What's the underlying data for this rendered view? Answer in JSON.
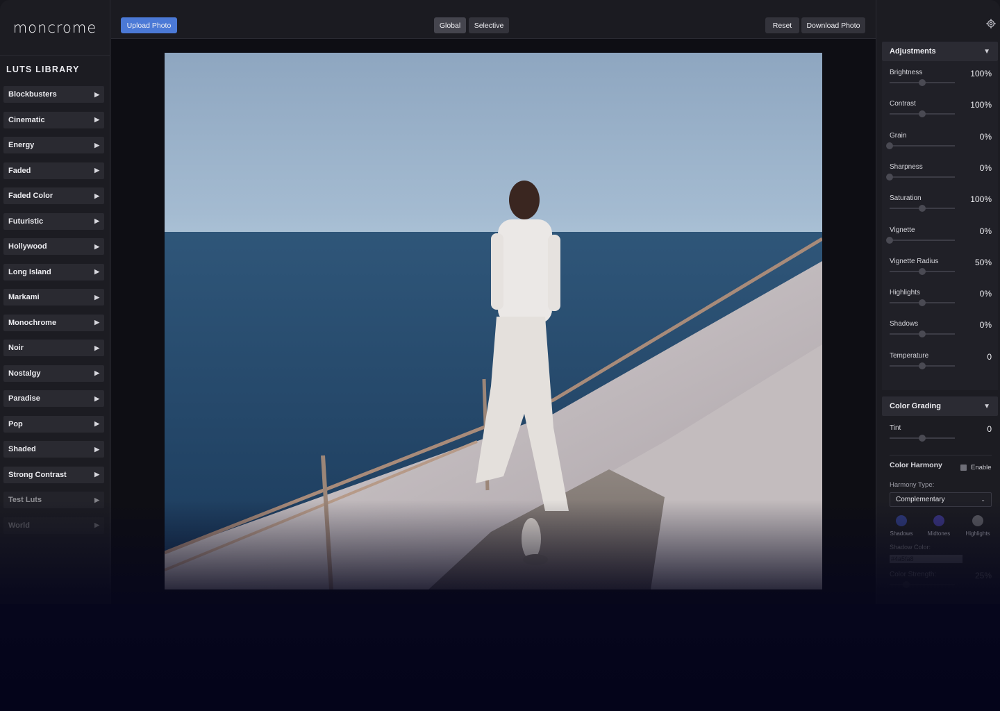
{
  "app": {
    "logo": "moncrome"
  },
  "sidebar": {
    "title": "LUTS LIBRARY",
    "items": [
      "Blockbusters",
      "Cinematic",
      "Energy",
      "Faded",
      "Faded Color",
      "Futuristic",
      "Hollywood",
      "Long Island",
      "Markami",
      "Monochrome",
      "Noir",
      "Nostalgy",
      "Paradise",
      "Pop",
      "Shaded",
      "Strong Contrast",
      "Test Luts",
      "World"
    ]
  },
  "toolbar": {
    "upload_label": "Upload Photo",
    "global_label": "Global",
    "selective_label": "Selective",
    "reset_label": "Reset",
    "download_label": "Download Photo"
  },
  "adjustments": {
    "title": "Adjustments",
    "sliders": [
      {
        "label": "Brightness",
        "value": "100%",
        "pos": 0.5
      },
      {
        "label": "Contrast",
        "value": "100%",
        "pos": 0.5
      },
      {
        "label": "Grain",
        "value": "0%",
        "pos": 0
      },
      {
        "label": "Sharpness",
        "value": "0%",
        "pos": 0
      },
      {
        "label": "Saturation",
        "value": "100%",
        "pos": 0.5
      },
      {
        "label": "Vignette",
        "value": "0%",
        "pos": 0
      },
      {
        "label": "Vignette Radius",
        "value": "50%",
        "pos": 0.5
      },
      {
        "label": "Highlights",
        "value": "0%",
        "pos": 0.5
      },
      {
        "label": "Shadows",
        "value": "0%",
        "pos": 0.5
      },
      {
        "label": "Temperature",
        "value": "0",
        "pos": 0.5
      }
    ]
  },
  "color_grading": {
    "title": "Color Grading",
    "tint": {
      "label": "Tint",
      "value": "0",
      "pos": 0.5
    },
    "harmony": {
      "title": "Color Harmony",
      "enable_label": "Enable",
      "type_label": "Harmony Type:",
      "type_value": "Complementary",
      "swatches": [
        {
          "label": "Shadows",
          "color": "#2f3a7a"
        },
        {
          "label": "Midtones",
          "color": "#3a3580"
        },
        {
          "label": "Highlights",
          "color": "#5a5a60"
        }
      ],
      "shadow_color_label": "Shadow Color:",
      "shadow_color_value": "#4a5fa8",
      "strength_label": "Color Strength:",
      "strength_value": "25%",
      "strength_pos": 0.25
    }
  }
}
